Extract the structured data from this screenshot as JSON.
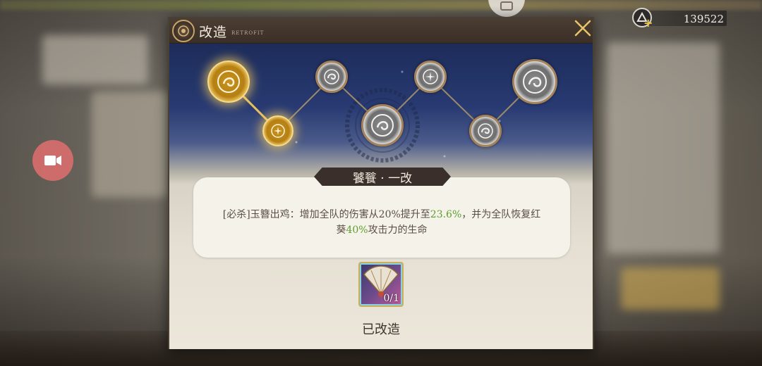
{
  "currency": {
    "value": "139522",
    "icon": "coin-icon"
  },
  "dialog": {
    "title": "改造",
    "subtitle": "RETROFIT",
    "close_icon": "close-icon"
  },
  "nodes": [
    {
      "id": "node-1",
      "state": "unlocked",
      "kind": "large"
    },
    {
      "id": "node-2",
      "state": "unlocked",
      "kind": "small"
    },
    {
      "id": "node-3",
      "state": "locked",
      "kind": "small"
    },
    {
      "id": "node-4",
      "state": "locked",
      "kind": "large"
    },
    {
      "id": "node-5",
      "state": "locked",
      "kind": "small"
    },
    {
      "id": "node-6",
      "state": "locked",
      "kind": "small"
    },
    {
      "id": "node-7",
      "state": "locked",
      "kind": "large"
    }
  ],
  "banner": {
    "title": "饕餮 · 一改"
  },
  "description": {
    "part1": "[必杀]玉簪出鸡：增加全队的伤害从20%提升至",
    "highlight1": "23.6%",
    "part2": "，并为全队恢复红葵",
    "highlight2": "40%",
    "part3": "攻击力的生命"
  },
  "material": {
    "count": "0/1",
    "icon": "fan-icon"
  },
  "status": {
    "label": "已改造"
  },
  "colors": {
    "accent_gold": "#e8c15c",
    "highlight_green": "#5d9e2f",
    "header_brown": "#3a2f27"
  }
}
